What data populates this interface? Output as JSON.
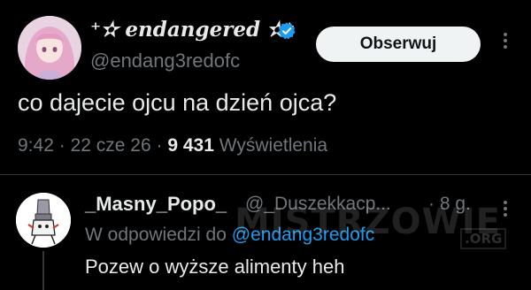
{
  "tweet": {
    "display_name": "⁺✫ endangered ✫⁺",
    "handle": "@endang3redofc",
    "follow_label": "Obserwuj",
    "text": "co dajecie ojcu na dzień ojca?",
    "time": "9:42",
    "sep1": "·",
    "date": "22 cze 26",
    "sep2": "·",
    "views_count": "9 431",
    "views_label": "Wyświetlenia"
  },
  "reply": {
    "display_name": "_Masny_Popo_",
    "handle": "@_Duszekkacp...",
    "time": "· 8 g.",
    "reply_prefix": "W odpowiedzi do",
    "reply_mention": "@endang3redofc",
    "text": "Pozew o wyższe alimenty heh"
  },
  "watermark": {
    "text": "MISTRZOWIE",
    "org": ".ORG"
  },
  "icons": {
    "verified": "verified-badge-icon",
    "more": "more-options-icon"
  },
  "colors": {
    "background": "#000000",
    "text": "#e7e9ea",
    "muted": "#71767b",
    "accent": "#1d9bf0",
    "button_bg": "#eff3f4"
  }
}
